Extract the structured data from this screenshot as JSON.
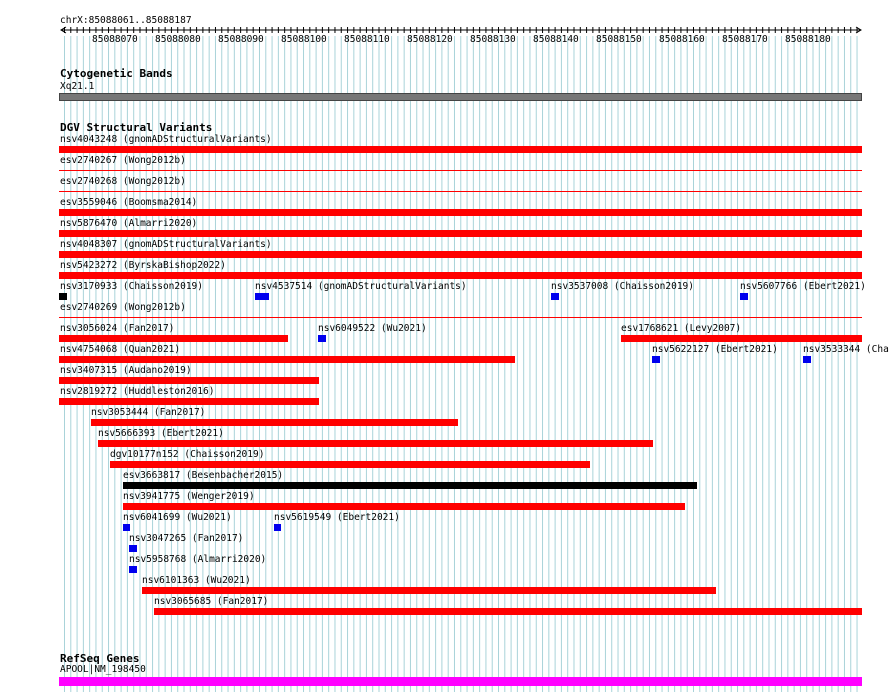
{
  "ruler": {
    "position_label": "chrX:85088061..85088187",
    "ticks": [
      "85088070",
      "85088080",
      "85088090",
      "85088100",
      "85088110",
      "85088120",
      "85088130",
      "85088140",
      "85088150",
      "85088160",
      "85088170",
      "85088180"
    ]
  },
  "cytoband": {
    "title": "Cytogenetic Bands",
    "band": "Xq21.1"
  },
  "dgv": {
    "title": "DGV Structural Variants"
  },
  "refseq": {
    "title": "RefSeq Genes",
    "gene": "APOOL|NM_198450"
  },
  "colors": {
    "loss": "#ff0000",
    "gain": "#0000ee",
    "complex": "#000000",
    "gene": "#ff00ff",
    "band": "#777777",
    "grid": "#a9d3d9"
  },
  "variants": [
    {
      "id": "v01",
      "label": "nsv4043248 (gnomADStructuralVariants)",
      "type": "loss"
    },
    {
      "id": "v02",
      "label": "esv2740267 (Wong2012b)",
      "type": "loss"
    },
    {
      "id": "v03",
      "label": "esv2740268 (Wong2012b)",
      "type": "loss"
    },
    {
      "id": "v04",
      "label": "esv3559046 (Boomsma2014)",
      "type": "loss"
    },
    {
      "id": "v05",
      "label": "nsv5876470 (Almarri2020)",
      "type": "loss"
    },
    {
      "id": "v06",
      "label": "nsv4048307 (gnomADStructuralVariants)",
      "type": "loss"
    },
    {
      "id": "v07",
      "label": "nsv5423272 (ByrskaBishop2022)",
      "type": "loss"
    },
    {
      "id": "v08",
      "label": "nsv3170933 (Chaisson2019)",
      "type": "complex"
    },
    {
      "id": "v09",
      "label": "nsv4537514 (gnomADStructuralVariants)",
      "type": "gain"
    },
    {
      "id": "v10",
      "label": "nsv3537008 (Chaisson2019)",
      "type": "gain"
    },
    {
      "id": "v11",
      "label": "nsv5607766 (Ebert2021)",
      "type": "gain"
    },
    {
      "id": "v12",
      "label": "esv2740269 (Wong2012b)",
      "type": "loss"
    },
    {
      "id": "v13",
      "label": "nsv3056024 (Fan2017)",
      "type": "loss"
    },
    {
      "id": "v14",
      "label": "nsv6049522 (Wu2021)",
      "type": "gain"
    },
    {
      "id": "v15",
      "label": "esv1768621 (Levy2007)",
      "type": "loss"
    },
    {
      "id": "v16",
      "label": "nsv4754068 (Quan2021)",
      "type": "loss"
    },
    {
      "id": "v17",
      "label": "nsv5622127 (Ebert2021)",
      "type": "gain"
    },
    {
      "id": "v18",
      "label": "nsv3533344 (Cha",
      "type": "gain"
    },
    {
      "id": "v19",
      "label": "nsv3407315 (Audano2019)",
      "type": "loss"
    },
    {
      "id": "v20",
      "label": "nsv2819272 (Huddleston2016)",
      "type": "loss"
    },
    {
      "id": "v21",
      "label": "nsv3053444 (Fan2017)",
      "type": "loss"
    },
    {
      "id": "v22",
      "label": "nsv5666393 (Ebert2021)",
      "type": "loss"
    },
    {
      "id": "v23",
      "label": "dgv10177n152 (Chaisson2019)",
      "type": "loss"
    },
    {
      "id": "v24",
      "label": "esv3663817 (Besenbacher2015)",
      "type": "complex"
    },
    {
      "id": "v25",
      "label": "nsv3941775 (Wenger2019)",
      "type": "loss"
    },
    {
      "id": "v26",
      "label": "nsv6041699 (Wu2021)",
      "type": "gain"
    },
    {
      "id": "v27",
      "label": "nsv5619549 (Ebert2021)",
      "type": "gain"
    },
    {
      "id": "v28",
      "label": "nsv3047265 (Fan2017)",
      "type": "gain"
    },
    {
      "id": "v29",
      "label": "nsv5958768 (Almarri2020)",
      "type": "gain"
    },
    {
      "id": "v30",
      "label": "nsv6101363 (Wu2021)",
      "type": "loss"
    },
    {
      "id": "v31",
      "label": "nsv3065685 (Fan2017)",
      "type": "loss"
    }
  ]
}
